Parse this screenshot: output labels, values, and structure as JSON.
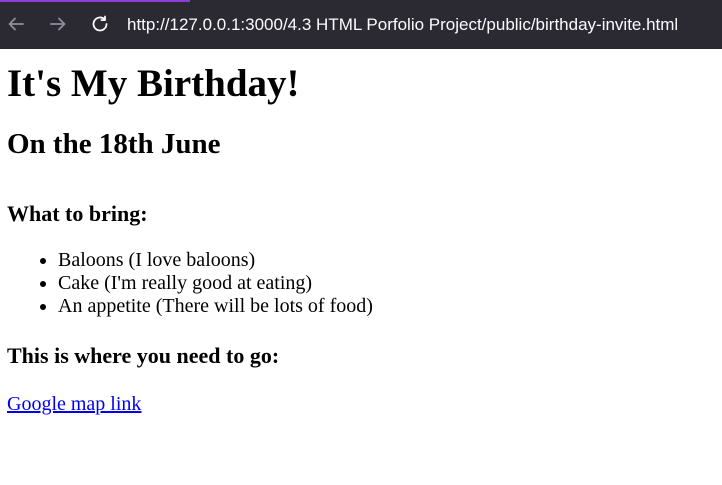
{
  "browser": {
    "url": "http://127.0.0.1:3000/4.3 HTML Porfolio Project/public/birthday-invite.html",
    "back_icon": "arrow-left-icon",
    "forward_icon": "arrow-right-icon",
    "reload_icon": "reload-icon",
    "bar_color": "#2b2a33"
  },
  "page": {
    "title": "It's My Birthday!",
    "date": "On the 18th June",
    "bring_heading": "What to bring:",
    "bring_items": [
      "Baloons (I love baloons)",
      "Cake (I'm really good at eating)",
      "An appetite (There will be lots of food)"
    ],
    "where_heading": "This is where you need to go:",
    "map_link": "Google map link",
    "link_color": "#0000ee"
  }
}
